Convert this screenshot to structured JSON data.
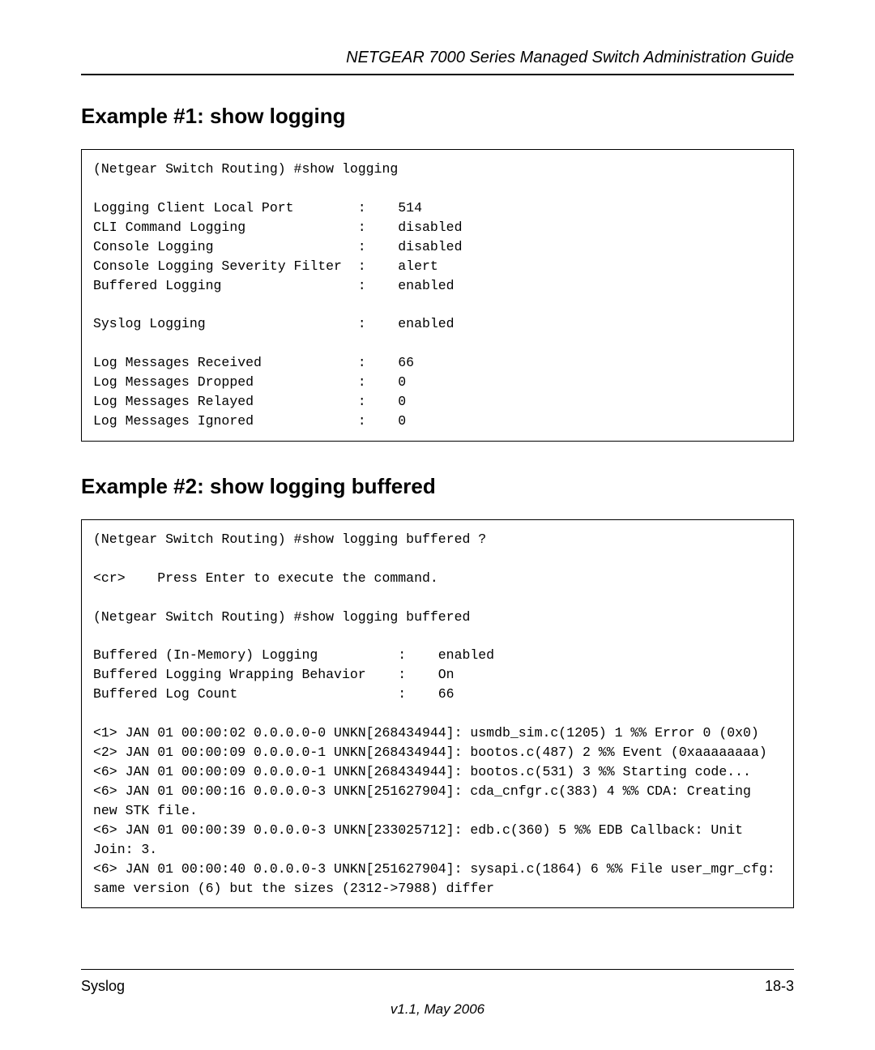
{
  "header": {
    "title": "NETGEAR 7000  Series Managed Switch Administration Guide"
  },
  "example1": {
    "heading": "Example #1: show logging",
    "code": "(Netgear Switch Routing) #show logging\n\nLogging Client Local Port        :    514\nCLI Command Logging              :    disabled\nConsole Logging                  :    disabled\nConsole Logging Severity Filter  :    alert\nBuffered Logging                 :    enabled\n\nSyslog Logging                   :    enabled\n\nLog Messages Received            :    66\nLog Messages Dropped             :    0\nLog Messages Relayed             :    0\nLog Messages Ignored             :    0"
  },
  "example2": {
    "heading": "Example #2: show logging buffered",
    "code": "(Netgear Switch Routing) #show logging buffered ?\n\n<cr>    Press Enter to execute the command.\n\n(Netgear Switch Routing) #show logging buffered\n\nBuffered (In-Memory) Logging          :    enabled\nBuffered Logging Wrapping Behavior    :    On\nBuffered Log Count                    :    66\n\n<1> JAN 01 00:00:02 0.0.0.0-0 UNKN[268434944]: usmdb_sim.c(1205) 1 %% Error 0 (0x0)\n<2> JAN 01 00:00:09 0.0.0.0-1 UNKN[268434944]: bootos.c(487) 2 %% Event (0xaaaaaaaa)\n<6> JAN 01 00:00:09 0.0.0.0-1 UNKN[268434944]: bootos.c(531) 3 %% Starting code...\n<6> JAN 01 00:00:16 0.0.0.0-3 UNKN[251627904]: cda_cnfgr.c(383) 4 %% CDA: Creating new STK file.\n<6> JAN 01 00:00:39 0.0.0.0-3 UNKN[233025712]: edb.c(360) 5 %% EDB Callback: Unit Join: 3.\n<6> JAN 01 00:00:40 0.0.0.0-3 UNKN[251627904]: sysapi.c(1864) 6 %% File user_mgr_cfg: same version (6) but the sizes (2312->7988) differ"
  },
  "footer": {
    "left": "Syslog",
    "right": "18-3",
    "version": "v1.1, May 2006"
  }
}
